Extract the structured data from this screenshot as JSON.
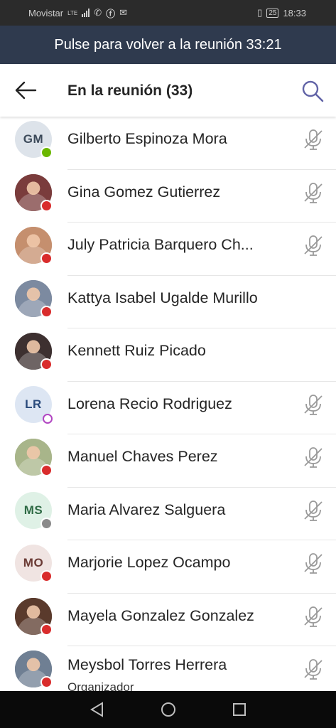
{
  "status_bar": {
    "carrier": "Movistar",
    "network": "LTE",
    "battery": "25",
    "time": "18:33"
  },
  "banner": {
    "text": "Pulse para volver a la reunión 33:21"
  },
  "header": {
    "title": "En la reunión (33)"
  },
  "participants": [
    {
      "name": "Gilberto Espinoza Mora",
      "initials": "GM",
      "avatar_bg": "#dde3ea",
      "avatar_fg": "#3c4a5a",
      "status": "available",
      "status_color": "#6bb700",
      "muted": true
    },
    {
      "name": "Gina Gomez Gutierrez",
      "initials": "",
      "avatar_bg": "#7a3c3c",
      "status": "busy",
      "status_color": "#d92c2c",
      "muted": true
    },
    {
      "name": "July Patricia Barquero Ch...",
      "initials": "",
      "avatar_bg": "#c58f6e",
      "status": "busy",
      "status_color": "#d92c2c",
      "muted": true
    },
    {
      "name": "Kattya Isabel Ugalde Murillo",
      "initials": "",
      "avatar_bg": "#7c8aa0",
      "status": "busy",
      "status_color": "#d92c2c",
      "muted": false
    },
    {
      "name": "Kennett Ruiz Picado",
      "initials": "",
      "avatar_bg": "#3d3030",
      "status": "busy",
      "status_color": "#d92c2c",
      "muted": false
    },
    {
      "name": "Lorena Recio Rodriguez",
      "initials": "LR",
      "avatar_bg": "#dde6f3",
      "avatar_fg": "#2a4b7c",
      "status": "away",
      "status_color": "#b146c2",
      "muted": true
    },
    {
      "name": "Manuel Chaves Perez",
      "initials": "",
      "avatar_bg": "#a8b58a",
      "status": "busy",
      "status_color": "#d92c2c",
      "muted": true
    },
    {
      "name": "Maria Alvarez Salguera",
      "initials": "MS",
      "avatar_bg": "#dff1e6",
      "avatar_fg": "#2f6b45",
      "status": "offline",
      "status_color": "#8a8a8a",
      "muted": true
    },
    {
      "name": "Marjorie Lopez Ocampo",
      "initials": "MO",
      "avatar_bg": "#f0e4e2",
      "avatar_fg": "#6b3b35",
      "status": "busy",
      "status_color": "#d92c2c",
      "muted": true
    },
    {
      "name": "Mayela Gonzalez Gonzalez",
      "initials": "",
      "avatar_bg": "#5a3a2c",
      "status": "busy",
      "status_color": "#d92c2c",
      "muted": true
    },
    {
      "name": "Meysbol Torres Herrera",
      "role": "Organizador",
      "initials": "",
      "avatar_bg": "#6f7f93",
      "status": "dnd",
      "status_color": "#d92c2c",
      "muted": true
    }
  ],
  "colors": {
    "accent": "#6264a7",
    "banner": "#2f3a4e",
    "icon_gray": "#9a9a9a"
  }
}
